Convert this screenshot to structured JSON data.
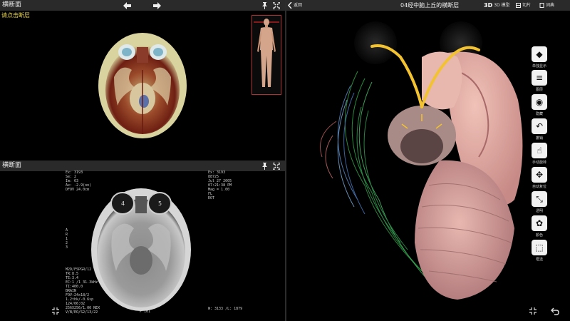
{
  "left_top": {
    "title": "横断面",
    "hint": "请点击断层",
    "icons": [
      "arrow-left-icon",
      "arrow-right-icon",
      "pin-icon",
      "fullscreen-icon"
    ]
  },
  "left_bottom": {
    "title": "横断面",
    "mri_overlay": {
      "top_left": "Ex: 3193\nSe: 2\nIm: 63\nAx: -2.9(on)\nDFOV 24.0cm",
      "top_right": "Ex: 3193\n88725\nJul 27 2005\n07:21:38 PM\nMag = 1.00\nFL\nROT",
      "bottom_left": "M2D/FSPGR/12\nTR:8.5\nTE:3.4\nEC:1 /1 31.3kHz\nTI:400.0\nBRAIN\nFOV:24x18/2\n1.2thk/-0.6sp\n124/06:02\n256X256/1.00 NEX\nV/B/EO/S2/13/22",
      "bottom_center": "P 101",
      "bottom_right": "W: 3133 /L: 1879",
      "left_marks": "A\nR\n1\n2\n3",
      "eye_labels": [
        "4",
        "5"
      ]
    }
  },
  "right": {
    "back_label": "返回",
    "title": "04经中脑上丘的横断层",
    "top_buttons": [
      {
        "icon": "3d-view-icon",
        "label": "3D 模型"
      },
      {
        "icon": "slice-icon",
        "label": "切片"
      },
      {
        "icon": "dictionary-icon",
        "label": "词典"
      }
    ],
    "tools": [
      {
        "icon": "single-show-icon",
        "label": "单独显示"
      },
      {
        "icon": "layers-icon",
        "label": "图层"
      },
      {
        "icon": "eye-icon",
        "label": "隐藏"
      },
      {
        "icon": "undo-icon",
        "label": "撤销"
      },
      {
        "icon": "touch-rotate-icon",
        "label": "手动旋转"
      },
      {
        "icon": "auto-reset-icon",
        "label": "自动复位"
      },
      {
        "icon": "transparent-icon",
        "label": "透明"
      },
      {
        "icon": "palette-icon",
        "label": "颜色"
      },
      {
        "icon": "select-icon",
        "label": "框选"
      }
    ]
  }
}
